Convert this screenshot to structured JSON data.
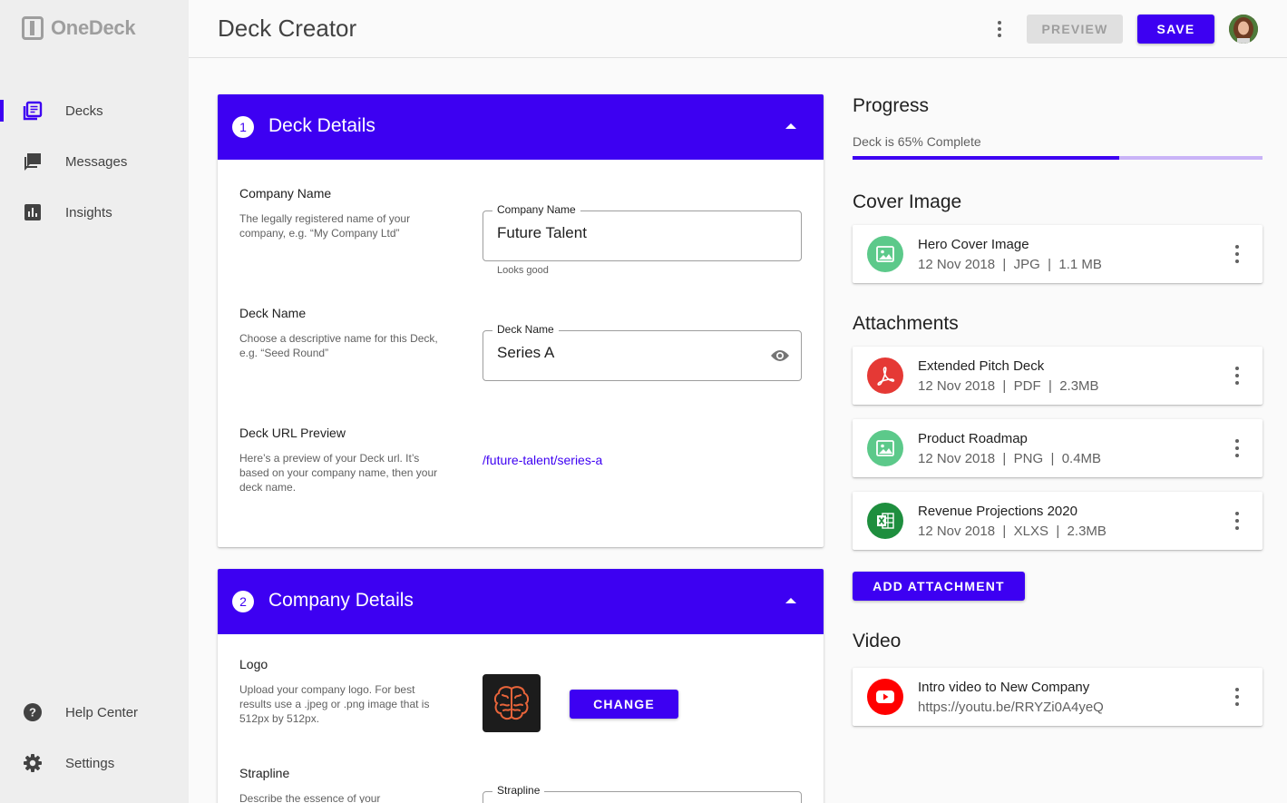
{
  "app": {
    "name": "OneDeck"
  },
  "sidebar": {
    "items": [
      {
        "label": "Decks",
        "icon": "decks-icon",
        "active": true
      },
      {
        "label": "Messages",
        "icon": "messages-icon"
      },
      {
        "label": "Insights",
        "icon": "insights-icon"
      }
    ],
    "bottom_items": [
      {
        "label": "Help Center",
        "icon": "help-icon"
      },
      {
        "label": "Settings",
        "icon": "settings-icon"
      }
    ]
  },
  "header": {
    "title": "Deck Creator",
    "preview_label": "PREVIEW",
    "save_label": "SAVE"
  },
  "deck_details": {
    "step": "1",
    "title": "Deck Details",
    "company_name": {
      "title": "Company Name",
      "description": "The legally registered name of your company, e.g. “My Company Ltd”",
      "label": "Company Name",
      "value": "Future Talent",
      "helper": "Looks good"
    },
    "deck_name": {
      "title": "Deck Name",
      "description": "Choose a descriptive name for this Deck, e.g. “Seed Round”",
      "label": "Deck Name",
      "value": "Series A"
    },
    "url_preview": {
      "title": "Deck URL Preview",
      "description": "Here’s a preview of your Deck url. It’s based on your company name, then your deck name.",
      "url": "/future-talent/series-a"
    }
  },
  "company_details": {
    "step": "2",
    "title": "Company Details",
    "logo": {
      "title": "Logo",
      "description": "Upload your company logo. For best results use a .jpeg or .png image that is 512px by 512px.",
      "change_label": "CHANGE"
    },
    "strapline": {
      "title": "Strapline",
      "description": "Describe the essence of your",
      "label": "Strapline"
    }
  },
  "progress": {
    "title": "Progress",
    "text": "Deck is 65% Complete",
    "percent": 65
  },
  "cover_image": {
    "title": "Cover Image",
    "file": {
      "name": "Hero Cover Image",
      "meta": "12 Nov 2018  |  JPG  |  1.1 MB",
      "icon": "image-icon"
    }
  },
  "attachments": {
    "title": "Attachments",
    "files": [
      {
        "name": "Extended Pitch Deck",
        "meta": "12 Nov 2018  |  PDF  |  2.3MB",
        "icon": "pdf-icon"
      },
      {
        "name": "Product Roadmap",
        "meta": "12 Nov 2018  |  PNG  |  0.4MB",
        "icon": "image-icon"
      },
      {
        "name": "Revenue Projections 2020",
        "meta": "12 Nov 2018  |  XLXS  |  2.3MB",
        "icon": "spreadsheet-icon"
      }
    ],
    "add_label": "ADD ATTACHMENT"
  },
  "video": {
    "title": "Video",
    "file": {
      "name": "Intro video to New Company",
      "meta": "https://youtu.be/RRYZi0A4yeQ",
      "icon": "youtube-icon"
    }
  },
  "colors": {
    "accent": "#3d00f2",
    "image_green": "#5cc98a",
    "pdf_red": "#e53935",
    "excel_green": "#1e8e3e",
    "youtube_red": "#ff0000"
  }
}
